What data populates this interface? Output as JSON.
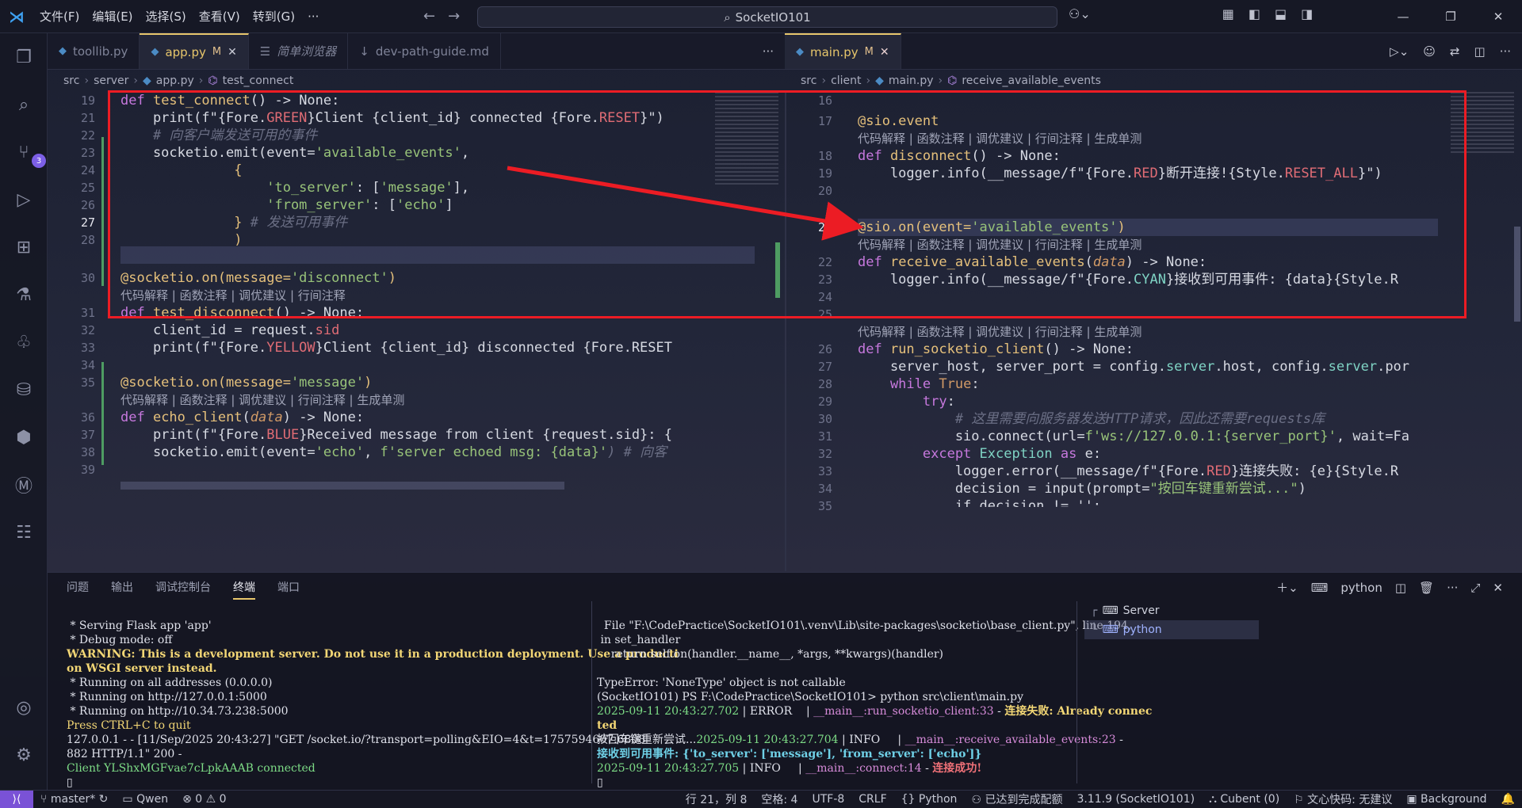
{
  "titlebar": {
    "menus": [
      "文件(F)",
      "编辑(E)",
      "选择(S)",
      "查看(V)",
      "转到(G)",
      "···"
    ],
    "search": "SocketIO101"
  },
  "activity": {
    "scm_badge": "3",
    "icons": [
      "explorer-icon",
      "search-icon",
      "source-control-icon",
      "run-debug-icon",
      "extensions-icon",
      "testing-icon",
      "python-icon",
      "database-icon",
      "copilot-icon",
      "markdown-icon",
      "docker-icon",
      "account-icon",
      "settings-icon"
    ]
  },
  "left": {
    "tabs": [
      {
        "label": "toollib.py",
        "state": ""
      },
      {
        "label": "app.py",
        "state": "M"
      },
      {
        "label": "简单浏览器",
        "state": ""
      },
      {
        "label": "dev-path-guide.md",
        "state": ""
      }
    ],
    "breadcrumb": [
      "src",
      "server",
      "app.py",
      "test_connect"
    ],
    "lens": "代码解释 | 函数注释 | 调优建议 | 行间注释",
    "lens_full": "代码解释 | 函数注释 | 调优建议 | 行间注释 | 生成单测",
    "lines": {
      "l19": "19",
      "l21": "21",
      "l22": "22",
      "l23": "23",
      "l24": "24",
      "l25": "25",
      "l26": "26",
      "l27": "27",
      "l28": "28",
      "l30": "30",
      "l31": "31",
      "l32": "32",
      "l33": "33",
      "l34": "34",
      "l35": "35",
      "l36": "36",
      "l37": "37",
      "l38": "38",
      "l39": "39"
    },
    "code": {
      "c19a": "def ",
      "c19b": "test_connect",
      "c19c": "() -> None:",
      "c21a": "    print(f\"{Fore.",
      "c21b": "GREEN",
      "c21c": "}Client {client_id} connected {Fore.",
      "c21d": "RESET",
      "c21e": "}\")",
      "c22": "    # 向客户端发送可用的事件",
      "c23a": "    socketio.emit(event=",
      "c23b": "'available_events'",
      "c23c": ",",
      "c24": "              {",
      "c25a": "                  ",
      "c25b": "'to_server'",
      "c25c": ": [",
      "c25d": "'message'",
      "c25e": "],",
      "c26a": "                  ",
      "c26b": "'from_server'",
      "c26c": ": [",
      "c26d": "'echo'",
      "c26e": "]",
      "c27a": "              }",
      "c27b": " # 发送可用事件",
      "c28": "              )",
      "c30a": "@socketio.on(message=",
      "c30b": "'disconnect'",
      "c30c": ")",
      "c31a": "def ",
      "c31b": "test_disconnect",
      "c31c": "() -> None:",
      "c32a": "    client_id = request.",
      "c32b": "sid",
      "c33a": "    print(f\"{Fore.",
      "c33b": "YELLOW",
      "c33c": "}Client {client_id} disconnected {Fore.RESET",
      "c35a": "@socketio.on(message=",
      "c35b": "'message'",
      "c35c": ")",
      "c36a": "def ",
      "c36b": "echo_client",
      "c36c": "(",
      "c36d": "data",
      "c36e": ") -> None:",
      "c37a": "    print(f\"{Fore.",
      "c37b": "BLUE",
      "c37c": "}Received message from client {request.sid}: {",
      "c38a": "    socketio.emit(event=",
      "c38b": "'echo'",
      "c38c": ", ",
      "c38d": "f'server echoed msg: {data}'",
      "c38e": ") # 向客"
    }
  },
  "right": {
    "tabs": [
      {
        "label": "main.py",
        "state": "M"
      }
    ],
    "breadcrumb": [
      "src",
      "client",
      "main.py",
      "receive_available_events"
    ],
    "lens": "代码解释 | 函数注释 | 调优建议 | 行间注释 | 生成单测",
    "lines": {
      "l16": "16",
      "l17": "17",
      "l18": "18",
      "l19": "19",
      "l20": "20",
      "l21": "21",
      "l22": "22",
      "l23": "23",
      "l24": "24",
      "l25": "25",
      "l26": "26",
      "l27": "27",
      "l28": "28",
      "l29": "29",
      "l30": "30",
      "l31": "31",
      "l32": "32",
      "l33": "33",
      "l34": "34",
      "l35": "35"
    },
    "code": {
      "c17": "@sio.event",
      "c18a": "def ",
      "c18b": "disconnect",
      "c18c": "() -> None:",
      "c19a": "    logger.info(__message/f\"{Fore.",
      "c19b": "RED",
      "c19c": "}断开连接!{Style.",
      "c19d": "RESET_ALL",
      "c19e": "}\")",
      "c21a": "@sio.on(event=",
      "c21b": "'available_events'",
      "c21c": ")",
      "c22a": "def ",
      "c22b": "receive_available_events",
      "c22c": "(",
      "c22d": "data",
      "c22e": ") -> None:",
      "c23a": "    logger.info(__message/f\"{Fore.",
      "c23b": "CYAN",
      "c23c": "}接收到可用事件: {data}{Style.R",
      "c26a": "def ",
      "c26b": "run_socketio_client",
      "c26c": "() -> None:",
      "c27a": "    server_host, server_port = config.",
      "c27b": "server",
      "c27c": ".host, config.",
      "c27d": "server",
      "c27e": ".por",
      "c28a": "    while ",
      "c28b": "True",
      "c28c": ":",
      "c29a": "        try",
      "c29b": ":",
      "c30": "            # 这里需要向服务器发送HTTP请求，因此还需要requests库",
      "c31a": "            sio.connect(url=",
      "c31b": "f'ws://127.0.0.1:{server_port}'",
      "c31c": ", wait=Fa",
      "c32a": "        except ",
      "c32b": "Exception ",
      "c32c": "as ",
      "c32d": "e:",
      "c33a": "            logger.error(__message/f\"{Fore.",
      "c33b": "RED",
      "c33c": "}连接失败: {e}{Style.R",
      "c34a": "            decision = input(prompt=",
      "c34b": "\"按回车键重新尝试...\"",
      "c34c": ")",
      "c35": "            if decision != '':"
    }
  },
  "panel": {
    "tabs": [
      "问题",
      "输出",
      "调试控制台",
      "终端",
      "端口"
    ],
    "active_tab": "终端",
    "shell": "python",
    "terminals": [
      "Server",
      "python"
    ],
    "left_term": [
      " * Serving Flask app 'app'",
      " * Debug mode: off",
      "WARNING: This is a development server. Do not use it in a production deployment. Use a producti",
      "on WSGI server instead.",
      " * Running on all addresses (0.0.0.0)",
      " * Running on http://127.0.0.1:5000",
      " * Running on http://10.34.73.238:5000",
      "Press CTRL+C to quit",
      "127.0.0.1 - - [11/Sep/2025 20:43:27] \"GET /socket.io/?transport=polling&EIO=4&t=1757594607.6808",
      "882 HTTP/1.1\" 200 -",
      "Client YLShxMGFvae7cLpkAAAB connected"
    ],
    "right_term": {
      "r1": "  File \"F:\\CodePractice\\SocketIO101\\.venv\\Lib\\site-packages\\socketio\\base_client.py\", line 194,",
      "r2": " in set_handler",
      "r3": "    return self.on(handler.__name__, *args, **kwargs)(handler)",
      "r4": "TypeError: 'NoneType' object is not callable",
      "r5": "(SocketIO101) PS F:\\CodePractice\\SocketIO101> python src\\client\\main.py",
      "r6a": "2025-09-11 20:43:27.702",
      "r6b": " | ERROR    | ",
      "r6c": "__main__:run_socketio_client:33",
      "r6d": " - ",
      "r6e": "连接失败: Already connec",
      "r7": "ted",
      "r8a": "按回车键重新尝试...",
      "r8b": "2025-09-11 20:43:27.704",
      "r8c": " | INFO     | ",
      "r8d": "__main__:receive_available_events:23",
      "r8e": " -",
      "r9": "接收到可用事件: {'to_server': ['message'], 'from_server': ['echo']}",
      "r10a": "2025-09-11 20:43:27.705",
      "r10b": " | INFO     | ",
      "r10c": "__main__:connect:14",
      "r10d": " - ",
      "r10e": "连接成功!"
    }
  },
  "status": {
    "branch": "master*",
    "qwen": "Qwen",
    "problems": "⊗ 0 ⚠ 0",
    "position": "行 21，列 8",
    "spaces": "空格: 4",
    "encoding": "UTF-8",
    "eol": "CRLF",
    "lang": "Python",
    "goal": "已达到完成配额",
    "env": "3.11.9 (SocketIO101)",
    "cubent": "Cubent (0)",
    "wenxin": "文心快码: 无建议",
    "bg": "Background"
  }
}
